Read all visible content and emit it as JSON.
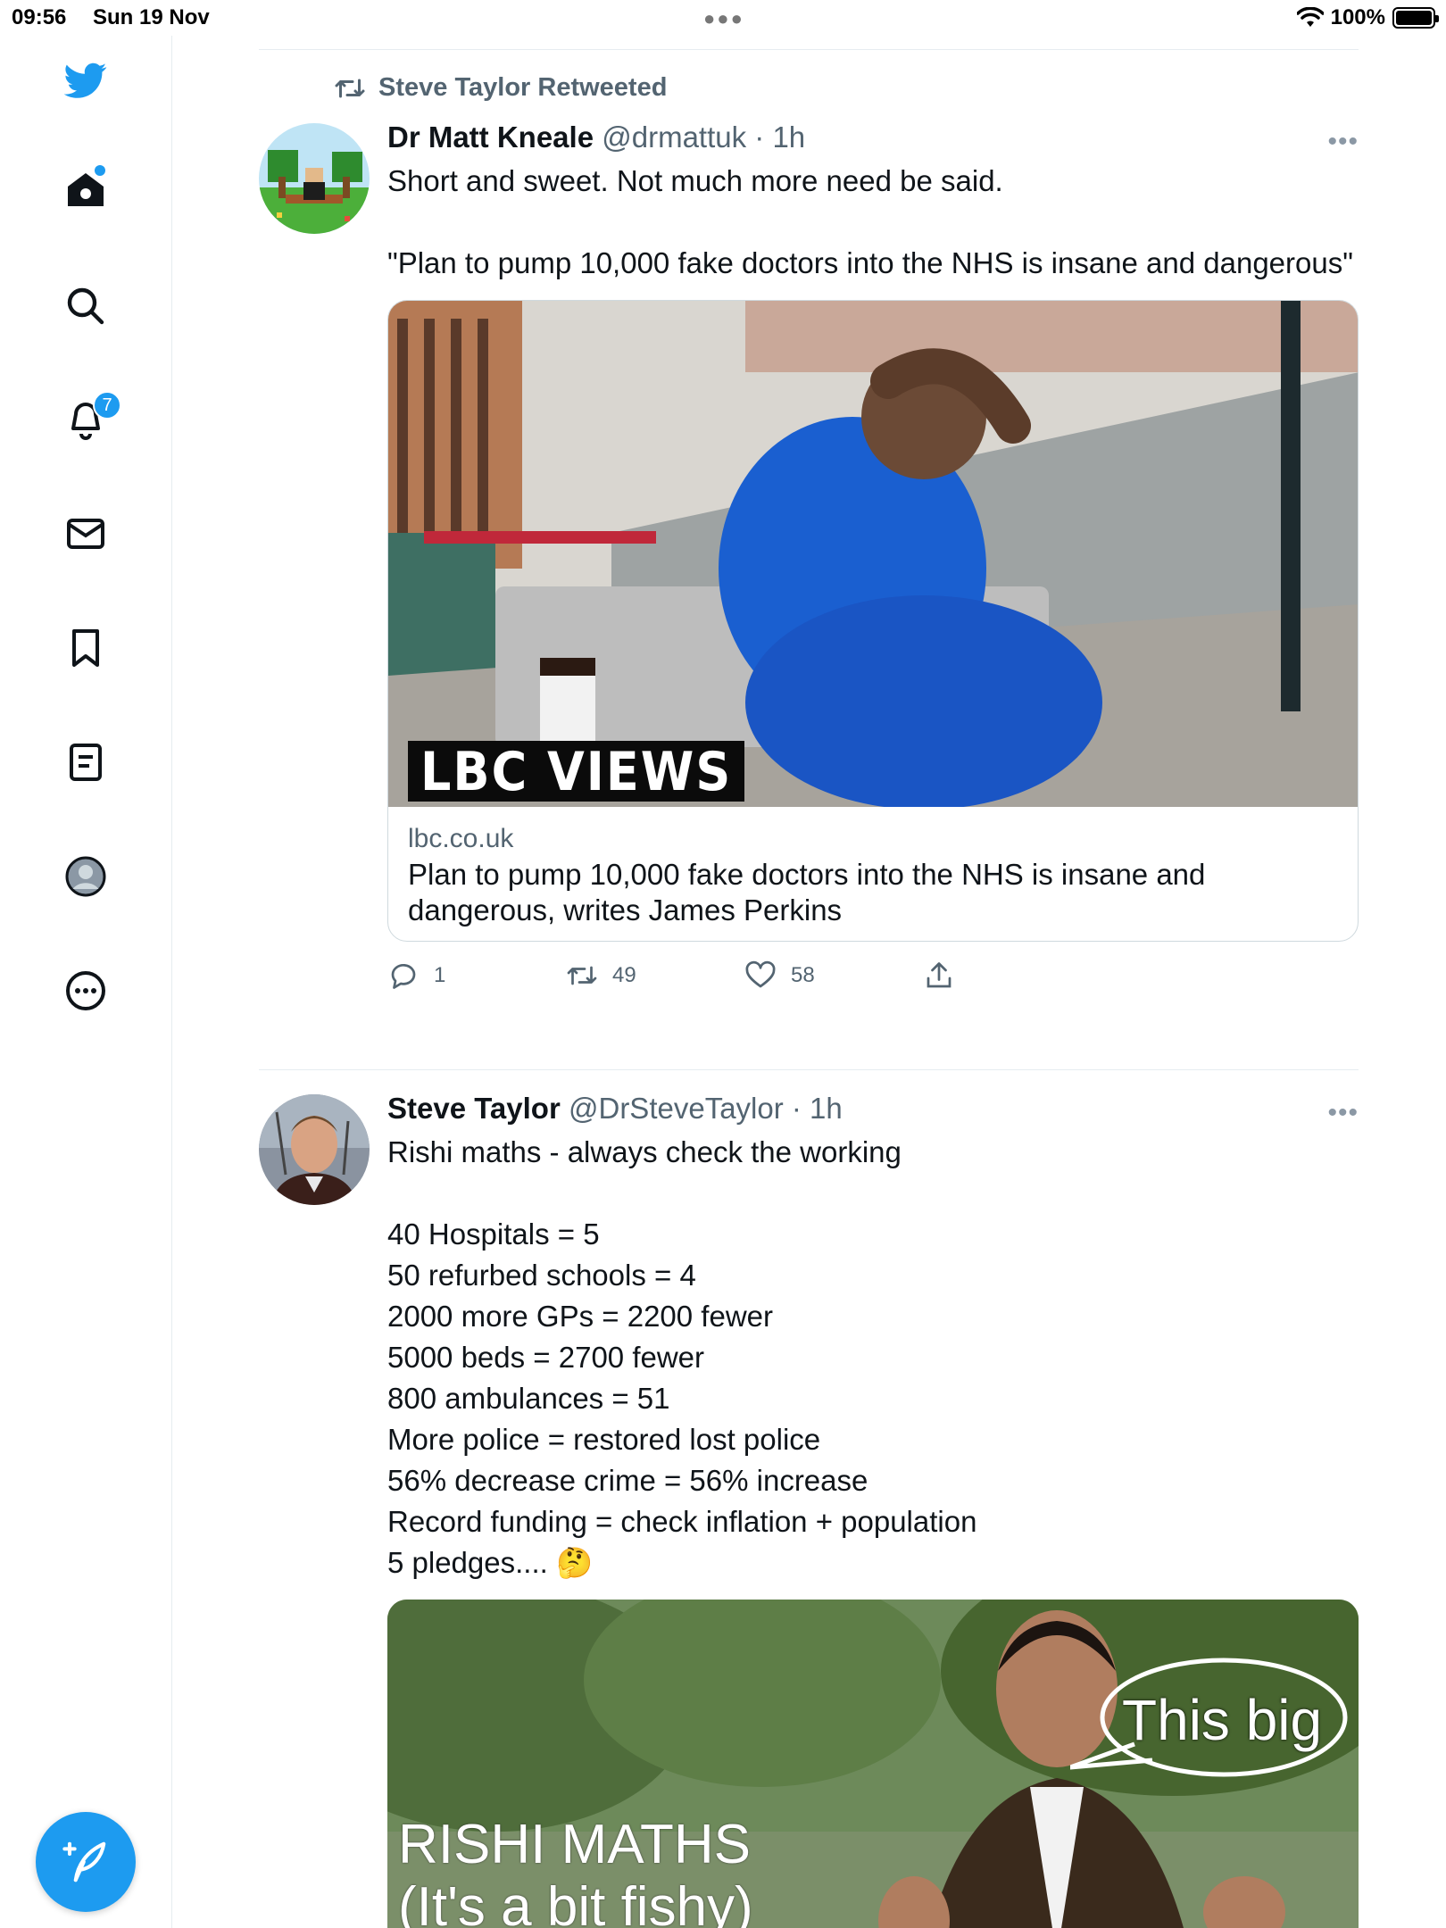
{
  "status_bar": {
    "time": "09:56",
    "date": "Sun 19 Nov",
    "battery": "100%"
  },
  "sidebar": {
    "notifications_count": "7",
    "icons": [
      "twitter-logo-icon",
      "home-icon",
      "search-icon",
      "notifications-icon",
      "messages-icon",
      "bookmarks-icon",
      "lists-icon",
      "profile-icon",
      "more-icon"
    ]
  },
  "colors": {
    "accent": "#1d9bf0",
    "text": "#0f1419",
    "muted": "#536471"
  },
  "tweets": [
    {
      "retweet_label": "Steve Taylor Retweeted",
      "name": "Dr Matt Kneale",
      "handle": "@drmattuk",
      "time": "· 1h",
      "text": "Short and sweet. Not much more need be said.\n\n\"Plan to pump 10,000 fake doctors into the NHS is insane and dangerous\"",
      "card": {
        "image_overlay": "LBC VIEWS",
        "domain": "lbc.co.uk",
        "title": "Plan to pump 10,000 fake doctors into the NHS is insane and dangerous, writes James Perkins"
      },
      "replies": "1",
      "retweets": "49",
      "likes": "58"
    },
    {
      "name": "Steve Taylor",
      "handle": "@DrSteveTaylor",
      "time": "· 1h",
      "text": "Rishi maths - always check the working\n\n40 Hospitals = 5\n50 refurbed schools = 4\n2000 more GPs = 2200 fewer\n5000 beds = 2700 fewer\n800 ambulances = 51\nMore police = restored lost police\n56% decrease crime = 56% increase\nRecord funding = check inflation + population\n5 pledges.... 🤔",
      "image_text_main": "RISHI MATHS",
      "image_text_sub": "(It's a bit fishy)",
      "speech_bubble": "This big"
    }
  ]
}
